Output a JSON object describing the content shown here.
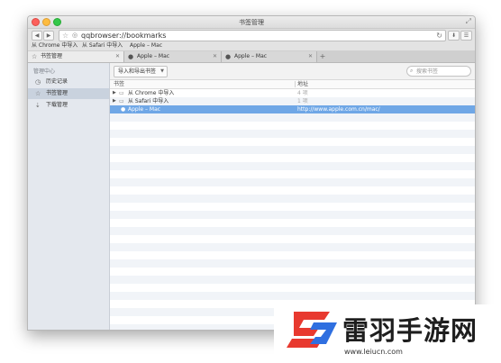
{
  "window": {
    "title": "书签管理"
  },
  "toolbar": {
    "back": "◀",
    "forward": "▶",
    "url": "qqbrowser://bookmarks"
  },
  "bookmark_bar": {
    "items": [
      "从 Chrome 中导入",
      "从 Safari 中导入",
      "Apple – Mac"
    ]
  },
  "tabs": [
    {
      "label": "书签管理",
      "icon": "star-icon",
      "active": true
    },
    {
      "label": "Apple – Mac",
      "icon": "apple-icon",
      "active": false
    },
    {
      "label": "Apple – Mac",
      "icon": "apple-icon",
      "active": false
    }
  ],
  "sidebar": {
    "heading": "管理中心",
    "items": [
      {
        "label": "历史记录",
        "icon": "clock-icon"
      },
      {
        "label": "书签管理",
        "icon": "star-icon",
        "active": true
      },
      {
        "label": "下载管理",
        "icon": "download-icon"
      }
    ]
  },
  "main": {
    "import_button": "导入和导出书签",
    "search_placeholder": "搜索书签",
    "columns": {
      "name": "书签",
      "address": "地址"
    },
    "rows": [
      {
        "name": "从 Chrome 中导入",
        "type": "folder",
        "count": "4 项"
      },
      {
        "name": "从 Safari 中导入",
        "type": "folder",
        "count": "1 项"
      },
      {
        "name": "Apple – Mac",
        "type": "bookmark",
        "address": "http://www.apple.com.cn/mac/",
        "selected": true
      }
    ]
  },
  "watermark": {
    "brand": "雷羽手游网",
    "url": "www.leiucn.com"
  },
  "colors": {
    "selection": "#6fa7e6",
    "sidebar_bg": "#e4e8ee",
    "logo_red": "#e8392f",
    "logo_blue": "#2f6fe0"
  }
}
